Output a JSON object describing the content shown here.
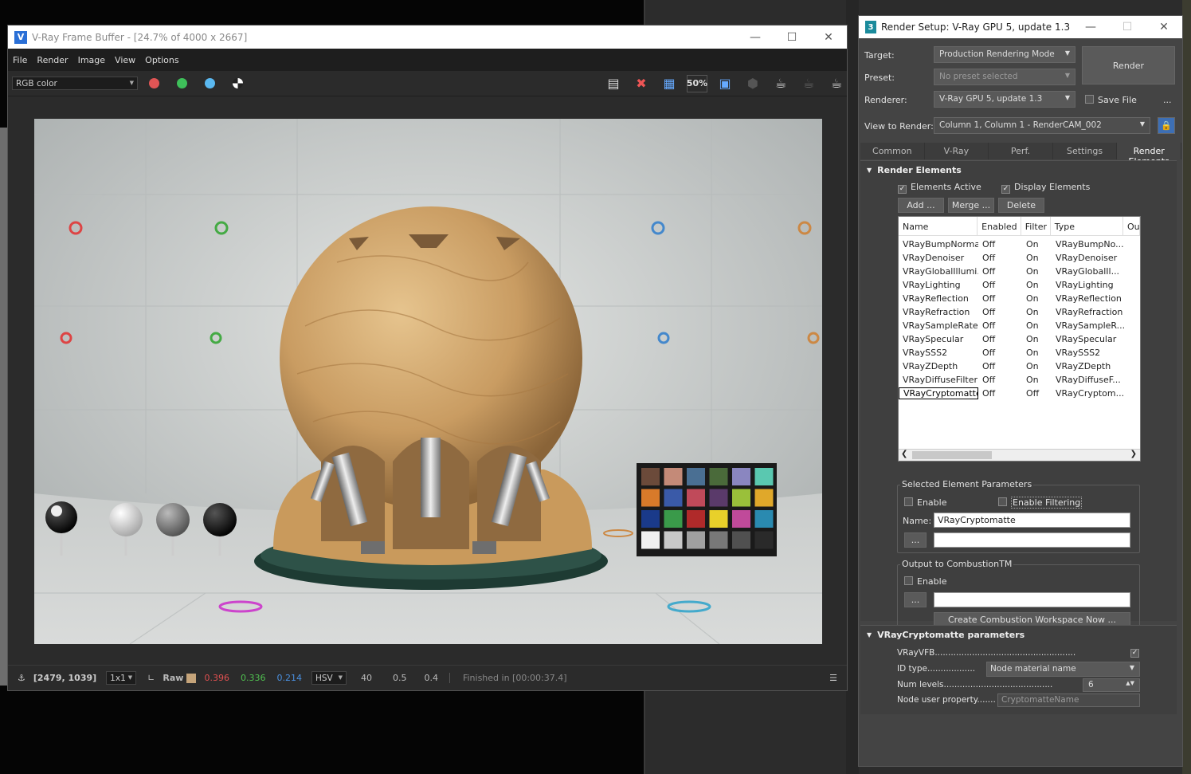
{
  "vfb": {
    "title": "V-Ray Frame Buffer - [24.7% of 4000 x 2667]",
    "menu": [
      "File",
      "Render",
      "Image",
      "View",
      "Options"
    ],
    "channel": "RGB color",
    "zoom_icon_label": "50%",
    "status": {
      "coords": "[2479, 1039]",
      "ratio": "1x1",
      "raw_label": "Raw",
      "r": "0.396",
      "g": "0.336",
      "b": "0.214",
      "mode": "HSV",
      "h": "40",
      "s": "0.5",
      "v": "0.4",
      "finished": "Finished in [00:00:37.4]"
    }
  },
  "colors": {
    "red_dot": "#e05555",
    "green_dot": "#3ec05a",
    "blue_dot": "#5ab8f0",
    "r_text": "#e05050",
    "g_text": "#50c050",
    "b_text": "#4a90e0"
  },
  "checker_colors": [
    "#6b4a3a",
    "#c48a78",
    "#4a6f93",
    "#4a6a3a",
    "#8a86c0",
    "#5ac8b0",
    "#d87a2a",
    "#3a5aa8",
    "#c04a5a",
    "#5a3a6a",
    "#9ac03a",
    "#e0a82a",
    "#1a3a8a",
    "#3a9a4a",
    "#b02a2a",
    "#e8d02a",
    "#c04a9a",
    "#2a8ab0",
    "#f0f0f0",
    "#c8c8c8",
    "#a0a0a0",
    "#787878",
    "#505050",
    "#2a2a2a"
  ],
  "rs": {
    "title": "Render Setup: V-Ray GPU 5, update 1.3",
    "target_label": "Target:",
    "target": "Production Rendering Mode",
    "preset_label": "Preset:",
    "preset": "No preset selected",
    "renderer_label": "Renderer:",
    "renderer": "V-Ray GPU 5, update 1.3",
    "save_file": "Save File",
    "dots": "...",
    "view_label": "View to Render:",
    "view": "Column 1, Column 1 - RenderCAM_002",
    "render_button": "Render",
    "tabs": [
      "Common",
      "V-Ray",
      "Perf.",
      "Settings",
      "Render Elements"
    ],
    "re": {
      "header": "Render Elements",
      "elements_active": "Elements Active",
      "display_elements": "Display Elements",
      "add": "Add ...",
      "merge": "Merge ...",
      "delete": "Delete",
      "cols": [
        "Name",
        "Enabled",
        "Filter",
        "Type",
        "Ou"
      ],
      "rows": [
        [
          "VRayBumpNormals",
          "Off",
          "On",
          "VRayBumpNo..."
        ],
        [
          "VRayDenoiser",
          "Off",
          "On",
          "VRayDenoiser"
        ],
        [
          "VRayGlobalIllumi...",
          "Off",
          "On",
          "VRayGlobalIl..."
        ],
        [
          "VRayLighting",
          "Off",
          "On",
          "VRayLighting"
        ],
        [
          "VRayReflection",
          "Off",
          "On",
          "VRayReflection"
        ],
        [
          "VRayRefraction",
          "Off",
          "On",
          "VRayRefraction"
        ],
        [
          "VRaySampleRate",
          "Off",
          "On",
          "VRaySampleR..."
        ],
        [
          "VRaySpecular",
          "Off",
          "On",
          "VRaySpecular"
        ],
        [
          "VRaySSS2",
          "Off",
          "On",
          "VRaySSS2"
        ],
        [
          "VRayZDepth",
          "Off",
          "On",
          "VRayZDepth"
        ],
        [
          "VRayDiffuseFilter",
          "Off",
          "On",
          "VRayDiffuseF..."
        ],
        [
          "VRayCryptomatte",
          "Off",
          "Off",
          "VRayCryptom..."
        ]
      ],
      "sel_params": "Selected Element Parameters",
      "enable": "Enable",
      "enable_filtering": "Enable Filtering",
      "name_label": "Name:",
      "name_value": "VRayCryptomatte",
      "browse": "...",
      "combustion": "Output to CombustionTM",
      "combustion_enable": "Enable",
      "create_ws": "Create Combustion Workspace Now ..."
    },
    "crypto": {
      "header": "VRayCryptomatte parameters",
      "vrayvfb": "VRayVFB.....................................................",
      "idtype_label": "ID type..................",
      "idtype": "Node material name",
      "numlevels_label": "Num levels.........................................",
      "numlevels": "6",
      "nodeuser_label": "Node user property.......",
      "nodeuser": "CryptomatteName"
    }
  }
}
